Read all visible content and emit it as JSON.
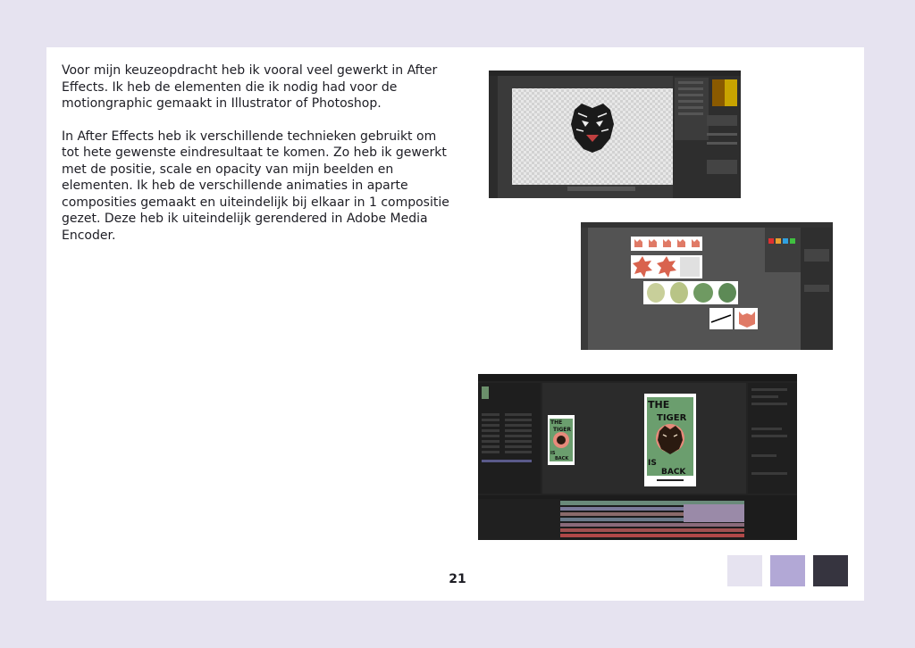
{
  "paragraphs": [
    "Voor mijn keuzeopdracht heb ik vooral veel gewerkt in After Effects. Ik heb de elementen die ik nodig had voor de motiongraphic gemaakt in Illustrator of Photoshop.",
    "In After Effects heb ik verschillende technieken gebruikt om tot hete gewenste eindresultaat te komen. Zo heb ik gewerkt met de positie, scale en opacity van mijn beelden en elementen. Ik heb de verschillende animaties in aparte composities gemaakt en uiteindelijk bij elkaar in 1 compositie gezet. Deze heb ik uiteindelijk gerendered in Adobe Media Encoder."
  ],
  "page_number": "21",
  "poster_text": {
    "line1": "THE",
    "line2": "TIGER",
    "line3": "IS",
    "line4": "BACK"
  },
  "swatches": [
    "#e6e3f0",
    "#b2a8d6",
    "#36343f"
  ],
  "screenshots": [
    {
      "app": "Photoshop",
      "icon": "tiger-head-icon"
    },
    {
      "app": "Illustrator",
      "icon": "artboards-icon"
    },
    {
      "app": "After Effects",
      "icon": "timeline-icon"
    }
  ]
}
